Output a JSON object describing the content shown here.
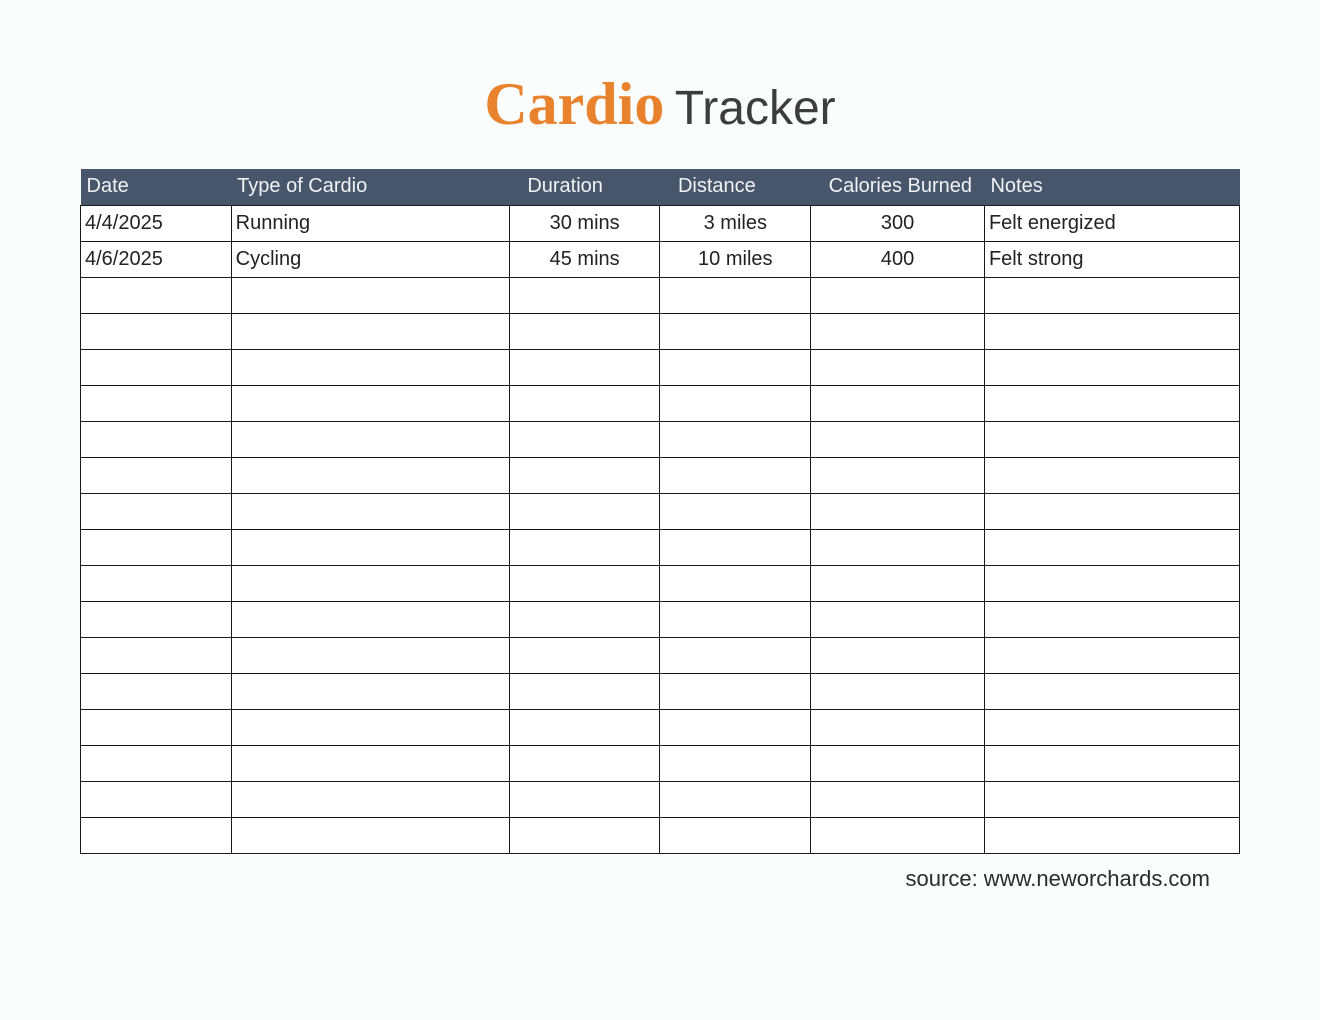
{
  "title": {
    "accent": "Cardio",
    "rest": "Tracker"
  },
  "columns": {
    "date": "Date",
    "type": "Type of Cardio",
    "duration": "Duration",
    "distance": "Distance",
    "calories": "Calories Burned",
    "notes": "Notes"
  },
  "rows": [
    {
      "date": "4/4/2025",
      "type": "Running",
      "duration": "30 mins",
      "distance": "3 miles",
      "calories": "300",
      "notes": "Felt energized"
    },
    {
      "date": "4/6/2025",
      "type": "Cycling",
      "duration": "45 mins",
      "distance": "10 miles",
      "calories": "400",
      "notes": "Felt strong"
    },
    {
      "date": "",
      "type": "",
      "duration": "",
      "distance": "",
      "calories": "",
      "notes": ""
    },
    {
      "date": "",
      "type": "",
      "duration": "",
      "distance": "",
      "calories": "",
      "notes": ""
    },
    {
      "date": "",
      "type": "",
      "duration": "",
      "distance": "",
      "calories": "",
      "notes": ""
    },
    {
      "date": "",
      "type": "",
      "duration": "",
      "distance": "",
      "calories": "",
      "notes": ""
    },
    {
      "date": "",
      "type": "",
      "duration": "",
      "distance": "",
      "calories": "",
      "notes": ""
    },
    {
      "date": "",
      "type": "",
      "duration": "",
      "distance": "",
      "calories": "",
      "notes": ""
    },
    {
      "date": "",
      "type": "",
      "duration": "",
      "distance": "",
      "calories": "",
      "notes": ""
    },
    {
      "date": "",
      "type": "",
      "duration": "",
      "distance": "",
      "calories": "",
      "notes": ""
    },
    {
      "date": "",
      "type": "",
      "duration": "",
      "distance": "",
      "calories": "",
      "notes": ""
    },
    {
      "date": "",
      "type": "",
      "duration": "",
      "distance": "",
      "calories": "",
      "notes": ""
    },
    {
      "date": "",
      "type": "",
      "duration": "",
      "distance": "",
      "calories": "",
      "notes": ""
    },
    {
      "date": "",
      "type": "",
      "duration": "",
      "distance": "",
      "calories": "",
      "notes": ""
    },
    {
      "date": "",
      "type": "",
      "duration": "",
      "distance": "",
      "calories": "",
      "notes": ""
    },
    {
      "date": "",
      "type": "",
      "duration": "",
      "distance": "",
      "calories": "",
      "notes": ""
    },
    {
      "date": "",
      "type": "",
      "duration": "",
      "distance": "",
      "calories": "",
      "notes": ""
    },
    {
      "date": "",
      "type": "",
      "duration": "",
      "distance": "",
      "calories": "",
      "notes": ""
    }
  ],
  "footer": {
    "source": "source: www.neworchards.com"
  }
}
